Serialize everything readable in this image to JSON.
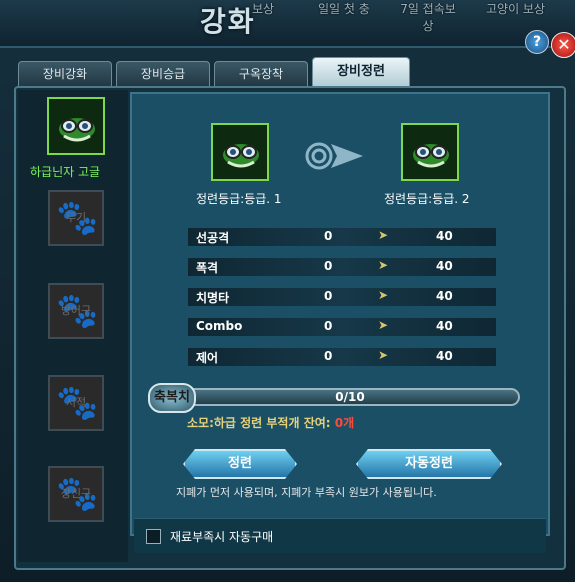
{
  "window": {
    "title": "강화",
    "top_nav": [
      "보상",
      "일일 첫 충",
      "7일 접속보상",
      "고양이 보상"
    ]
  },
  "tabs": [
    {
      "label": "장비강화",
      "active": false
    },
    {
      "label": "장비승급",
      "active": false
    },
    {
      "label": "구옥장착",
      "active": false
    },
    {
      "label": "장비정련",
      "active": true
    }
  ],
  "sidebar": {
    "selected_item": {
      "label": "하급닌자 고글"
    },
    "slots": [
      {
        "label": "무기"
      },
      {
        "label": "방어구"
      },
      {
        "label": "서적"
      },
      {
        "label": "장신구"
      }
    ]
  },
  "refine": {
    "current_grade": "정련등급:등급. 1",
    "next_grade": "정련등급:등급. 2",
    "stats": [
      {
        "name": "선공격",
        "from": "0",
        "to": "40"
      },
      {
        "name": "폭격",
        "from": "0",
        "to": "40"
      },
      {
        "name": "치명타",
        "from": "0",
        "to": "40"
      },
      {
        "name": "Combo",
        "from": "0",
        "to": "40"
      },
      {
        "name": "제어",
        "from": "0",
        "to": "40"
      }
    ],
    "blessing_label": "축복치",
    "blessing_value": "0/10",
    "blessing_progress": 0,
    "cost_prefix": "소모:하급 정련 부적개  잔여: ",
    "cost_remaining": "0개",
    "refine_button": "정련",
    "auto_refine_button": "자동정련",
    "note": "지폐가 먼저 사용되며, 지폐가 부족시 원보가 사용됩니다.",
    "auto_buy_label": "재료부족시 자동구매",
    "auto_buy_checked": false
  },
  "colors": {
    "accent": "#2575a8",
    "highlight_text": "#7ef25a",
    "warning_text": "#ff4a36"
  }
}
